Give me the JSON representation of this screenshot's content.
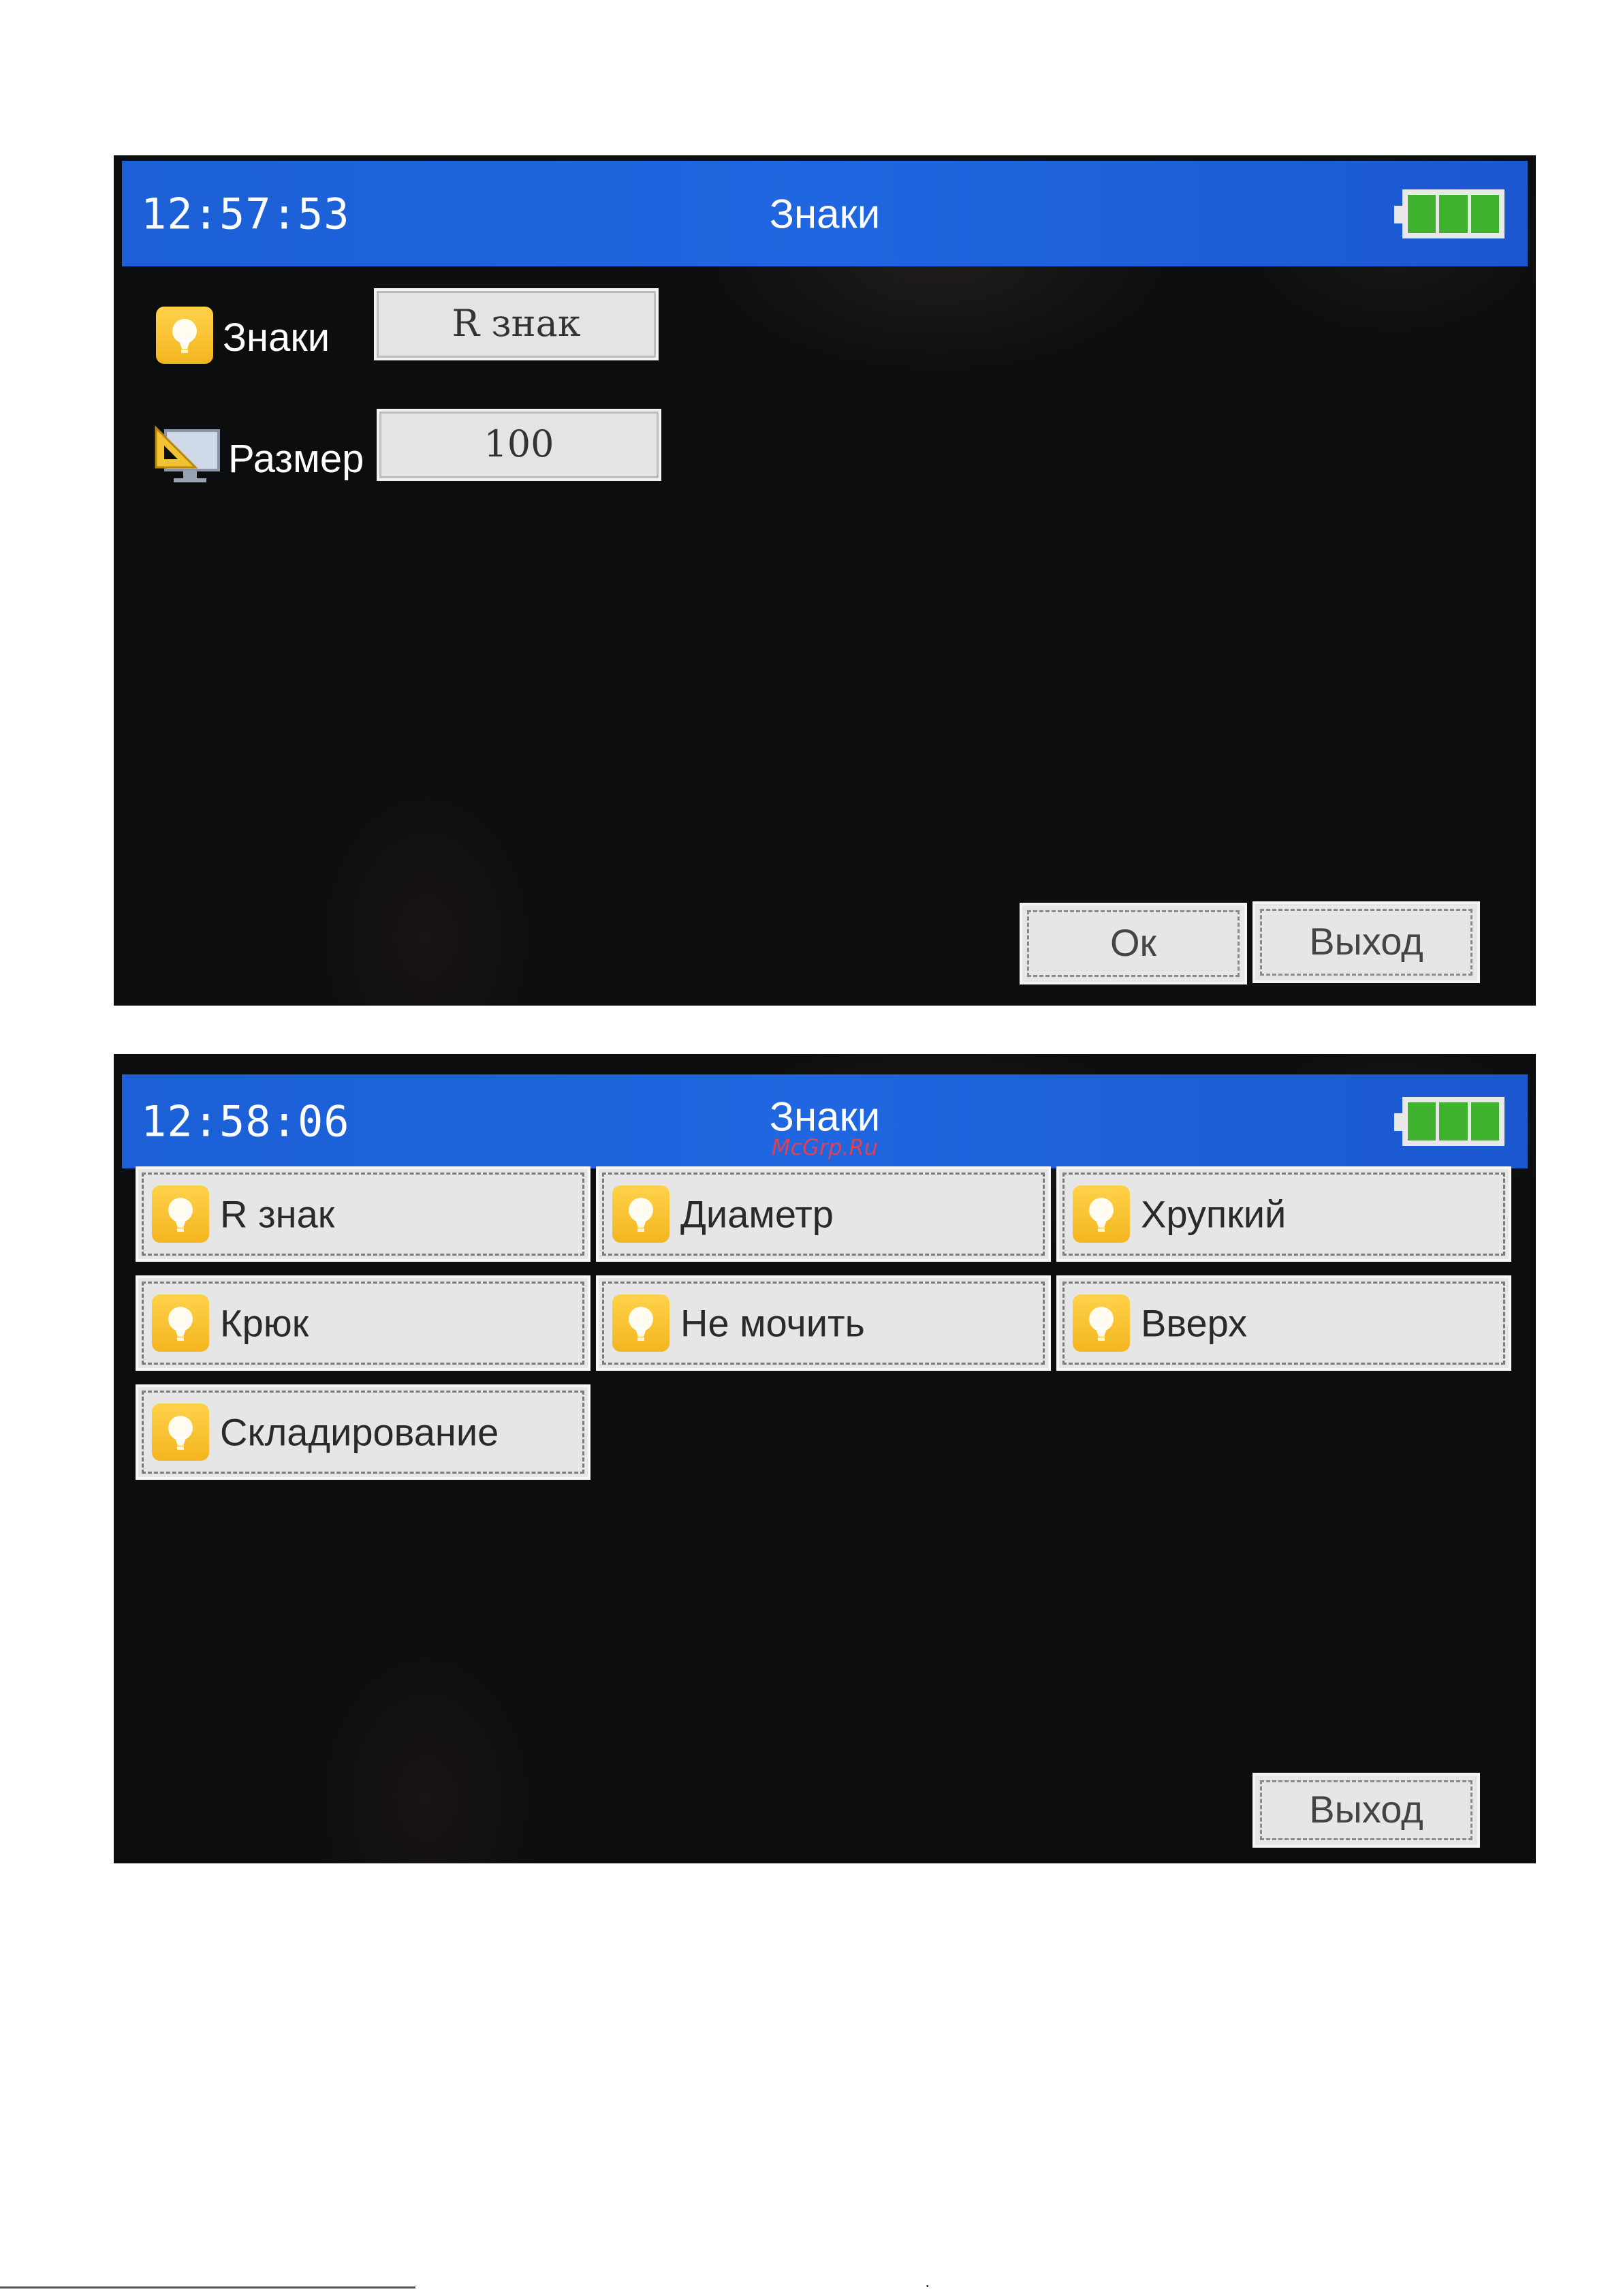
{
  "screen1": {
    "header": {
      "time": "12:57:53",
      "title": "Знаки",
      "battery_level": 1.0
    },
    "rows": [
      {
        "label": "Знаки",
        "icon": "bulb-icon",
        "value": "R знак"
      },
      {
        "label": "Размер",
        "icon": "ruler-monitor-icon",
        "value": "100"
      }
    ],
    "buttons": {
      "ok": "Ок",
      "exit": "Выход"
    }
  },
  "screen2": {
    "header": {
      "time": "12:58:06",
      "title": "Знаки",
      "battery_level": 1.0
    },
    "watermark": "McGrp.Ru",
    "options": [
      {
        "label": "R знак",
        "icon": "bulb-icon"
      },
      {
        "label": "Диаметр",
        "icon": "bulb-icon"
      },
      {
        "label": "Хрупкий",
        "icon": "bulb-icon"
      },
      {
        "label": "Крюк",
        "icon": "bulb-icon"
      },
      {
        "label": "Не мочить",
        "icon": "bulb-icon"
      },
      {
        "label": "Вверх",
        "icon": "bulb-icon"
      },
      {
        "label": "Складирование",
        "icon": "bulb-icon"
      }
    ],
    "buttons": {
      "exit": "Выход"
    }
  },
  "colors": {
    "header_blue": "#1f66e0",
    "screen_bg": "#0c0d0f",
    "icon_yellow": "#f3b51f",
    "battery_green": "#3fb22e",
    "button_bg": "#e6e6e6"
  }
}
